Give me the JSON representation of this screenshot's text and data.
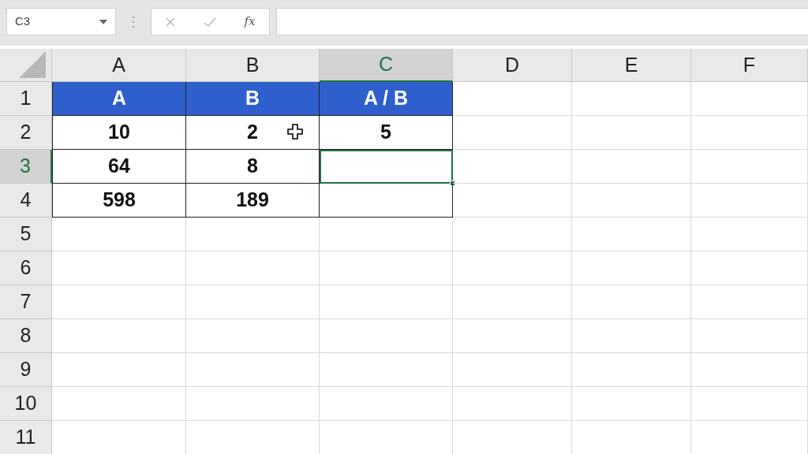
{
  "name_box": {
    "value": "C3"
  },
  "formula_bar": {
    "function_label": "fx"
  },
  "columns": [
    {
      "label": "A",
      "selected": false
    },
    {
      "label": "B",
      "selected": false
    },
    {
      "label": "C",
      "selected": true
    },
    {
      "label": "D",
      "selected": false
    },
    {
      "label": "E",
      "selected": false
    },
    {
      "label": "F",
      "selected": false
    }
  ],
  "rows": [
    {
      "label": "1",
      "selected": false,
      "cells": [
        {
          "kind": "header",
          "value": "A",
          "selected": false
        },
        {
          "kind": "header",
          "value": "B",
          "selected": false
        },
        {
          "kind": "header",
          "value": "A / B",
          "selected": false
        }
      ]
    },
    {
      "label": "2",
      "selected": false,
      "cells": [
        {
          "kind": "data",
          "value": "10",
          "selected": false
        },
        {
          "kind": "data",
          "value": "2",
          "selected": false
        },
        {
          "kind": "data",
          "value": "5",
          "selected": false
        }
      ]
    },
    {
      "label": "3",
      "selected": true,
      "cells": [
        {
          "kind": "data",
          "value": "64",
          "selected": false
        },
        {
          "kind": "data",
          "value": "8",
          "selected": false
        },
        {
          "kind": "data",
          "selected": true
        }
      ]
    },
    {
      "label": "4",
      "selected": false,
      "cells": [
        {
          "kind": "data",
          "value": "598",
          "selected": false
        },
        {
          "kind": "data",
          "value": "189",
          "selected": false
        },
        {
          "kind": "data",
          "selected": false
        }
      ]
    },
    {
      "label": "5",
      "selected": false
    },
    {
      "label": "6",
      "selected": false
    },
    {
      "label": "7",
      "selected": false
    },
    {
      "label": "8",
      "selected": false
    },
    {
      "label": "9",
      "selected": false
    },
    {
      "label": "10",
      "selected": false
    },
    {
      "label": "11",
      "selected": false
    }
  ]
}
